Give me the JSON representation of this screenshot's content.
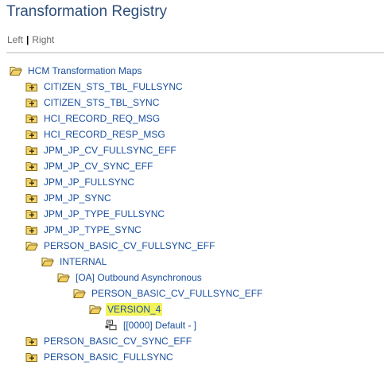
{
  "page": {
    "title": "Transformation Registry"
  },
  "nav": {
    "left": "Left",
    "separator": "|",
    "right": "Right"
  },
  "tree": {
    "root": "HCM Transformation Maps",
    "items": [
      {
        "label": "CITIZEN_STS_TBL_FULLSYNC",
        "state": "collapsed"
      },
      {
        "label": "CITIZEN_STS_TBL_SYNC",
        "state": "collapsed"
      },
      {
        "label": "HCI_RECORD_REQ_MSG",
        "state": "collapsed"
      },
      {
        "label": "HCI_RECORD_RESP_MSG",
        "state": "collapsed"
      },
      {
        "label": "JPM_JP_CV_FULLSYNC_EFF",
        "state": "collapsed"
      },
      {
        "label": "JPM_JP_CV_SYNC_EFF",
        "state": "collapsed"
      },
      {
        "label": "JPM_JP_FULLSYNC",
        "state": "collapsed"
      },
      {
        "label": "JPM_JP_SYNC",
        "state": "collapsed"
      },
      {
        "label": "JPM_JP_TYPE_FULLSYNC",
        "state": "collapsed"
      },
      {
        "label": "JPM_JP_TYPE_SYNC",
        "state": "collapsed"
      },
      {
        "label": "PERSON_BASIC_CV_FULLSYNC_EFF",
        "state": "open"
      },
      {
        "label": "PERSON_BASIC_CV_SYNC_EFF",
        "state": "collapsed"
      },
      {
        "label": "PERSON_BASIC_FULLSYNC",
        "state": "collapsed"
      }
    ],
    "expanded": {
      "internal": "INTERNAL",
      "outbound": "[OA] Outbound Asynchronous",
      "map": "PERSON_BASIC_CV_FULLSYNC_EFF",
      "version": "VERSION_4",
      "default": "[[0000] Default - ]"
    }
  },
  "colors": {
    "title": "#2f4f7a",
    "link": "#1a4fa0",
    "highlight": "#f2f25a",
    "folder": "#e7c84f"
  }
}
